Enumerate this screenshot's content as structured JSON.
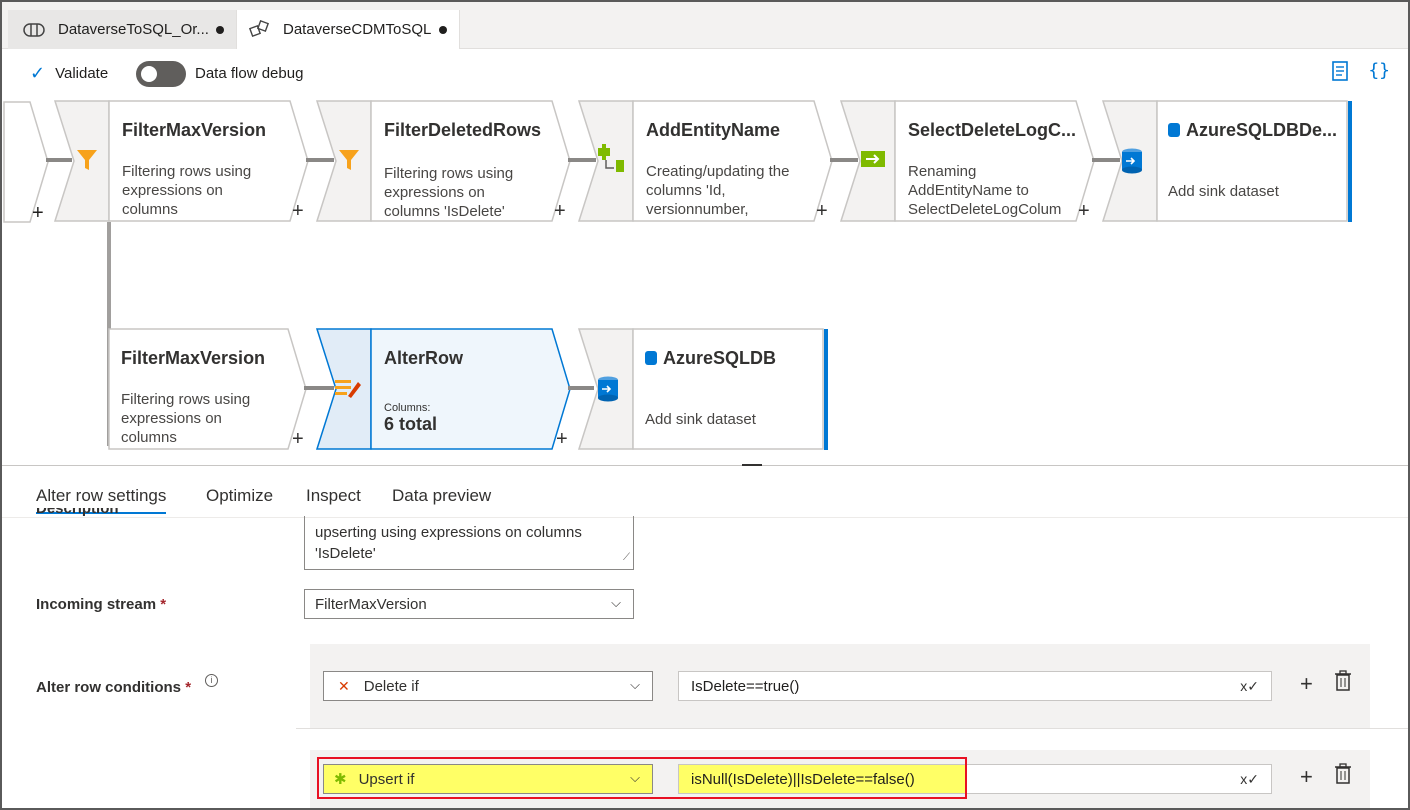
{
  "tabs": [
    {
      "label": "DataverseToSQL_Or...",
      "icon": "pipeline-icon",
      "unsaved": true
    },
    {
      "label": "DataverseCDMToSQL",
      "icon": "dataflow-icon",
      "unsaved": true
    }
  ],
  "toolbar": {
    "validate_label": "Validate",
    "debug_label": "Data flow debug",
    "debug_on": false
  },
  "canvas": {
    "top_row": [
      {
        "title": "FilterMaxVersion",
        "desc": "Filtering rows using expressions on columns",
        "icon": "filter-icon"
      },
      {
        "title": "FilterDeletedRows",
        "desc": "Filtering rows using expressions on columns 'IsDelete'",
        "icon": "filter-icon"
      },
      {
        "title": "AddEntityName",
        "desc": "Creating/updating the columns 'Id, versionnumber,",
        "icon": "derived-column-icon"
      },
      {
        "title": "SelectDeleteLogC...",
        "desc": "Renaming AddEntityName to SelectDeleteLogColum",
        "icon": "select-icon"
      },
      {
        "title": "AzureSQLDBDe...",
        "desc": "Add sink dataset",
        "icon": "sql-db-icon"
      }
    ],
    "bottom_row": [
      {
        "title": "FilterMaxVersion",
        "desc": "Filtering rows using expressions on columns"
      },
      {
        "title": "AlterRow",
        "columns_label": "Columns:",
        "columns_value": "6 total",
        "icon": "alter-row-icon"
      },
      {
        "title": "AzureSQLDB",
        "desc": "Add sink dataset",
        "icon": "sql-db-icon"
      }
    ]
  },
  "panel": {
    "tabs": [
      "Alter row settings",
      "Optimize",
      "Inspect",
      "Data preview"
    ],
    "active_tab": "Alter row settings",
    "description_label": "Description",
    "description_value": "upserting using expressions on columns 'IsDelete'",
    "incoming_label": "Incoming stream",
    "incoming_value": "FilterMaxVersion",
    "conditions_label": "Alter row conditions",
    "conditions": [
      {
        "type": "Delete if",
        "expression": "IsDelete==true()",
        "icon": "delete-x-icon"
      },
      {
        "type": "Upsert if",
        "expression": "isNull(IsDelete)||IsDelete==false()",
        "icon": "upsert-icon"
      }
    ]
  },
  "colors": {
    "accent": "#0078d4",
    "highlight": "#e81123",
    "yellow": "#ffff66"
  }
}
